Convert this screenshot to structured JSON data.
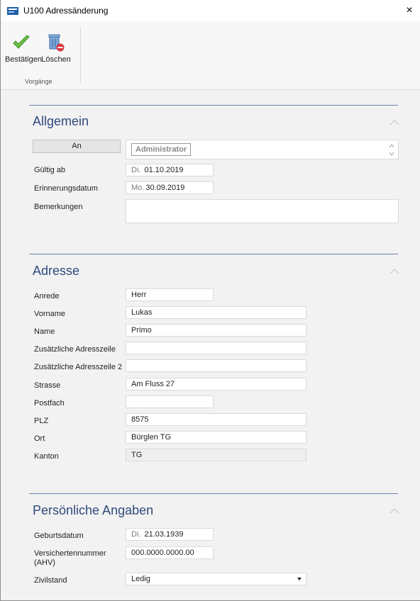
{
  "window": {
    "title": "U100 Adressänderung",
    "close_glyph": "×"
  },
  "ribbon": {
    "confirm_label": "Bestätigen",
    "delete_label": "Löschen",
    "group_label": "Vorgänge",
    "confirm_icon": "check-icon",
    "delete_icon": "trash-delete-icon"
  },
  "allgemein": {
    "title": "Allgemein",
    "an_button": "An",
    "an_chip": "Administrator",
    "gueltig_label": "Gültig ab",
    "gueltig_dow": "Di.",
    "gueltig_value": "01.10.2019",
    "erinnerung_label": "Erinnerungsdatum",
    "erinnerung_dow": "Mo.",
    "erinnerung_value": "30.09.2019",
    "bemerkungen_label": "Bemerkungen",
    "bemerkungen_value": ""
  },
  "adresse": {
    "title": "Adresse",
    "fields": [
      {
        "label": "Anrede",
        "value": "Herr"
      },
      {
        "label": "Vorname",
        "value": "Lukas"
      },
      {
        "label": "Name",
        "value": "Primo"
      },
      {
        "label": "Zusätzliche Adresszeile",
        "value": ""
      },
      {
        "label": "Zusätzliche Adresszeile 2",
        "value": ""
      },
      {
        "label": "Strasse",
        "value": "Am Fluss 27"
      },
      {
        "label": "Postfach",
        "value": ""
      },
      {
        "label": "PLZ",
        "value": "8575"
      },
      {
        "label": "Ort",
        "value": "Bürglen TG"
      },
      {
        "label": "Kanton",
        "value": "TG"
      }
    ]
  },
  "personal": {
    "title": "Persönliche Angaben",
    "geburtsdatum_label": "Geburtsdatum",
    "geburtsdatum_dow": "Di.",
    "geburtsdatum_value": "21.03.1939",
    "ahv_label_1": "Versichertennummer",
    "ahv_label_2": "(AHV)",
    "ahv_value": "000.0000.0000.00",
    "zivilstand_label": "Zivilstand",
    "zivilstand_value": "Ledig"
  },
  "colors": {
    "section_title": "#2e4a7c",
    "section_line": "#6a7fb0",
    "confirm_green": "#5cb85c",
    "delete_red": "#d9363e"
  }
}
